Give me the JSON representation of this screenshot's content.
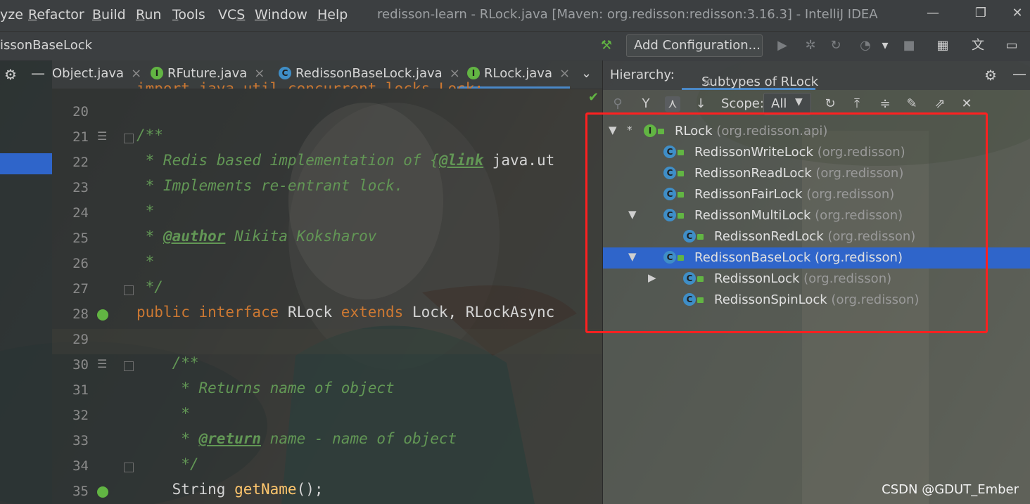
{
  "menu": {
    "items": [
      {
        "pre": "",
        "u": "",
        "post": "yze"
      },
      {
        "pre": "",
        "u": "R",
        "post": "efactor"
      },
      {
        "pre": "",
        "u": "B",
        "post": "uild"
      },
      {
        "pre": "",
        "u": "R",
        "post": "un"
      },
      {
        "pre": "",
        "u": "T",
        "post": "ools"
      },
      {
        "pre": "VC",
        "u": "S",
        "post": ""
      },
      {
        "pre": "",
        "u": "W",
        "post": "indow"
      },
      {
        "pre": "",
        "u": "H",
        "post": "elp"
      }
    ],
    "window_title": "redisson-learn - RLock.java [Maven: org.redisson:redisson:3.16.3] - IntelliJ IDEA"
  },
  "navbar": {
    "crumb": "issonBaseLock",
    "add_configuration": "Add Configuration..."
  },
  "editor": {
    "tabs": [
      {
        "label": "Object.java",
        "icon": "",
        "close": "×"
      },
      {
        "label": "RFuture.java",
        "icon": "I",
        "close": "×"
      },
      {
        "label": "RedissonBaseLock.java",
        "icon": "C",
        "close": "×"
      },
      {
        "label": "RLock.java",
        "icon": "I",
        "close": "×"
      }
    ],
    "tabs_more": "⌄",
    "partial_top": "import java.util.concurrent.locks.Lock;",
    "lines": [
      {
        "num": "20",
        "ann": "",
        "segs": []
      },
      {
        "num": "21",
        "ann": "doc",
        "segs": [
          {
            "c": "cm",
            "t": "/**"
          }
        ]
      },
      {
        "num": "22",
        "ann": "",
        "segs": [
          {
            "c": "cm",
            "t": " * Redis based implementation of {"
          },
          {
            "c": "cmt",
            "t": "@link"
          },
          {
            "c": "pl",
            "t": " java.ut"
          }
        ]
      },
      {
        "num": "23",
        "ann": "",
        "segs": [
          {
            "c": "cm",
            "t": " * Implements re-entrant lock."
          }
        ]
      },
      {
        "num": "24",
        "ann": "",
        "segs": [
          {
            "c": "cm",
            "t": " *"
          }
        ]
      },
      {
        "num": "25",
        "ann": "",
        "segs": [
          {
            "c": "cm",
            "t": " * "
          },
          {
            "c": "cmt",
            "t": "@author"
          },
          {
            "c": "cm",
            "t": " Nikita Koksharov"
          }
        ]
      },
      {
        "num": "26",
        "ann": "",
        "segs": [
          {
            "c": "cm",
            "t": " *"
          }
        ]
      },
      {
        "num": "27",
        "ann": "",
        "segs": [
          {
            "c": "cm",
            "t": " */"
          }
        ]
      },
      {
        "num": "28",
        "ann": "impl",
        "segs": [
          {
            "c": "kw",
            "t": "public interface "
          },
          {
            "c": "pl",
            "t": "RLock "
          },
          {
            "c": "kw",
            "t": "extends "
          },
          {
            "c": "pl",
            "t": "Lock, RLockAsync"
          }
        ]
      },
      {
        "num": "29",
        "ann": "",
        "segs": []
      },
      {
        "num": "30",
        "ann": "doc",
        "segs": [
          {
            "c": "cm",
            "t": "    /**"
          }
        ]
      },
      {
        "num": "31",
        "ann": "",
        "segs": [
          {
            "c": "cm",
            "t": "     * Returns name of object"
          }
        ]
      },
      {
        "num": "32",
        "ann": "",
        "segs": [
          {
            "c": "cm",
            "t": "     *"
          }
        ]
      },
      {
        "num": "33",
        "ann": "",
        "segs": [
          {
            "c": "cm",
            "t": "     * "
          },
          {
            "c": "cmt",
            "t": "@return"
          },
          {
            "c": "cm",
            "t": " name - name of object"
          }
        ]
      },
      {
        "num": "34",
        "ann": "",
        "segs": [
          {
            "c": "cm",
            "t": "     */"
          }
        ]
      },
      {
        "num": "35",
        "ann": "impl",
        "segs": [
          {
            "c": "pl",
            "t": "    String "
          },
          {
            "c": "fn",
            "t": "getName"
          },
          {
            "c": "pl",
            "t": "();"
          }
        ]
      }
    ]
  },
  "hierarchy": {
    "label": "Hierarchy:",
    "tab": "Subtypes of RLock",
    "tab_close": "×",
    "scope_label": "Scope:",
    "scope_value": "All",
    "nodes": [
      {
        "name": "RLock",
        "pkg": "(org.redisson.api)",
        "kind": "I",
        "arrow": "▼",
        "star": "*",
        "depth": 0,
        "selected": false
      },
      {
        "name": "RedissonWriteLock",
        "pkg": "(org.redisson)",
        "kind": "C",
        "arrow": "",
        "star": "",
        "depth": 1,
        "selected": false
      },
      {
        "name": "RedissonReadLock",
        "pkg": "(org.redisson)",
        "kind": "C",
        "arrow": "",
        "star": "",
        "depth": 1,
        "selected": false
      },
      {
        "name": "RedissonFairLock",
        "pkg": "(org.redisson)",
        "kind": "C",
        "arrow": "",
        "star": "",
        "depth": 1,
        "selected": false
      },
      {
        "name": "RedissonMultiLock",
        "pkg": "(org.redisson)",
        "kind": "C",
        "arrow": "▼",
        "star": "",
        "depth": 1,
        "selected": false
      },
      {
        "name": "RedissonRedLock",
        "pkg": "(org.redisson)",
        "kind": "C",
        "arrow": "",
        "star": "",
        "depth": 2,
        "selected": false
      },
      {
        "name": "RedissonBaseLock",
        "pkg": "(org.redisson)",
        "kind": "C",
        "arrow": "▼",
        "star": "",
        "depth": 1,
        "selected": true
      },
      {
        "name": "RedissonLock",
        "pkg": "(org.redisson)",
        "kind": "C",
        "arrow": "▶",
        "star": "",
        "depth": 2,
        "selected": false
      },
      {
        "name": "RedissonSpinLock",
        "pkg": "(org.redisson)",
        "kind": "C",
        "arrow": "",
        "star": "",
        "depth": 2,
        "selected": false
      }
    ]
  },
  "watermark": "CSDN @GDUT_Ember",
  "colors": {
    "selection": "#2f65ca",
    "highlight_box": "#ff2020",
    "comment": "#629755",
    "keyword": "#cc7832"
  }
}
